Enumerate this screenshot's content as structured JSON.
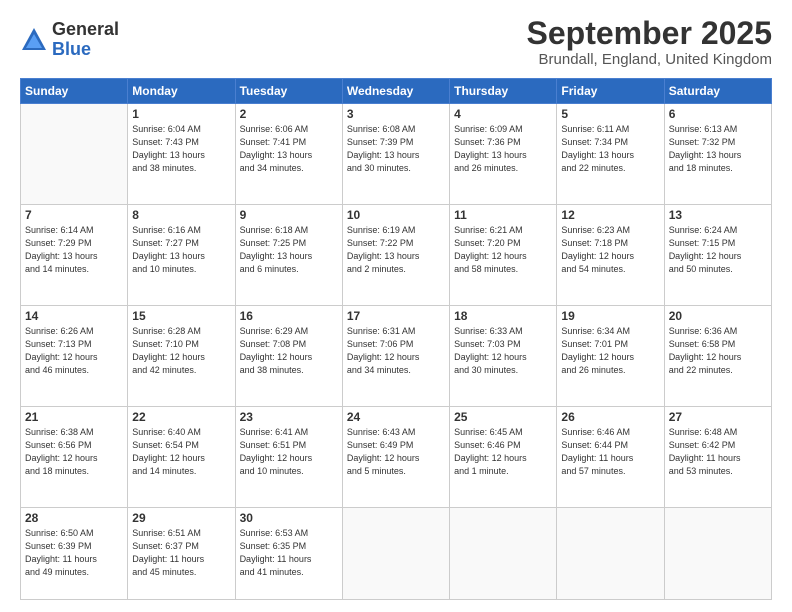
{
  "header": {
    "logo_general": "General",
    "logo_blue": "Blue",
    "month": "September 2025",
    "location": "Brundall, England, United Kingdom"
  },
  "weekdays": [
    "Sunday",
    "Monday",
    "Tuesday",
    "Wednesday",
    "Thursday",
    "Friday",
    "Saturday"
  ],
  "weeks": [
    [
      {
        "day": "",
        "info": ""
      },
      {
        "day": "1",
        "info": "Sunrise: 6:04 AM\nSunset: 7:43 PM\nDaylight: 13 hours\nand 38 minutes."
      },
      {
        "day": "2",
        "info": "Sunrise: 6:06 AM\nSunset: 7:41 PM\nDaylight: 13 hours\nand 34 minutes."
      },
      {
        "day": "3",
        "info": "Sunrise: 6:08 AM\nSunset: 7:39 PM\nDaylight: 13 hours\nand 30 minutes."
      },
      {
        "day": "4",
        "info": "Sunrise: 6:09 AM\nSunset: 7:36 PM\nDaylight: 13 hours\nand 26 minutes."
      },
      {
        "day": "5",
        "info": "Sunrise: 6:11 AM\nSunset: 7:34 PM\nDaylight: 13 hours\nand 22 minutes."
      },
      {
        "day": "6",
        "info": "Sunrise: 6:13 AM\nSunset: 7:32 PM\nDaylight: 13 hours\nand 18 minutes."
      }
    ],
    [
      {
        "day": "7",
        "info": "Sunrise: 6:14 AM\nSunset: 7:29 PM\nDaylight: 13 hours\nand 14 minutes."
      },
      {
        "day": "8",
        "info": "Sunrise: 6:16 AM\nSunset: 7:27 PM\nDaylight: 13 hours\nand 10 minutes."
      },
      {
        "day": "9",
        "info": "Sunrise: 6:18 AM\nSunset: 7:25 PM\nDaylight: 13 hours\nand 6 minutes."
      },
      {
        "day": "10",
        "info": "Sunrise: 6:19 AM\nSunset: 7:22 PM\nDaylight: 13 hours\nand 2 minutes."
      },
      {
        "day": "11",
        "info": "Sunrise: 6:21 AM\nSunset: 7:20 PM\nDaylight: 12 hours\nand 58 minutes."
      },
      {
        "day": "12",
        "info": "Sunrise: 6:23 AM\nSunset: 7:18 PM\nDaylight: 12 hours\nand 54 minutes."
      },
      {
        "day": "13",
        "info": "Sunrise: 6:24 AM\nSunset: 7:15 PM\nDaylight: 12 hours\nand 50 minutes."
      }
    ],
    [
      {
        "day": "14",
        "info": "Sunrise: 6:26 AM\nSunset: 7:13 PM\nDaylight: 12 hours\nand 46 minutes."
      },
      {
        "day": "15",
        "info": "Sunrise: 6:28 AM\nSunset: 7:10 PM\nDaylight: 12 hours\nand 42 minutes."
      },
      {
        "day": "16",
        "info": "Sunrise: 6:29 AM\nSunset: 7:08 PM\nDaylight: 12 hours\nand 38 minutes."
      },
      {
        "day": "17",
        "info": "Sunrise: 6:31 AM\nSunset: 7:06 PM\nDaylight: 12 hours\nand 34 minutes."
      },
      {
        "day": "18",
        "info": "Sunrise: 6:33 AM\nSunset: 7:03 PM\nDaylight: 12 hours\nand 30 minutes."
      },
      {
        "day": "19",
        "info": "Sunrise: 6:34 AM\nSunset: 7:01 PM\nDaylight: 12 hours\nand 26 minutes."
      },
      {
        "day": "20",
        "info": "Sunrise: 6:36 AM\nSunset: 6:58 PM\nDaylight: 12 hours\nand 22 minutes."
      }
    ],
    [
      {
        "day": "21",
        "info": "Sunrise: 6:38 AM\nSunset: 6:56 PM\nDaylight: 12 hours\nand 18 minutes."
      },
      {
        "day": "22",
        "info": "Sunrise: 6:40 AM\nSunset: 6:54 PM\nDaylight: 12 hours\nand 14 minutes."
      },
      {
        "day": "23",
        "info": "Sunrise: 6:41 AM\nSunset: 6:51 PM\nDaylight: 12 hours\nand 10 minutes."
      },
      {
        "day": "24",
        "info": "Sunrise: 6:43 AM\nSunset: 6:49 PM\nDaylight: 12 hours\nand 5 minutes."
      },
      {
        "day": "25",
        "info": "Sunrise: 6:45 AM\nSunset: 6:46 PM\nDaylight: 12 hours\nand 1 minute."
      },
      {
        "day": "26",
        "info": "Sunrise: 6:46 AM\nSunset: 6:44 PM\nDaylight: 11 hours\nand 57 minutes."
      },
      {
        "day": "27",
        "info": "Sunrise: 6:48 AM\nSunset: 6:42 PM\nDaylight: 11 hours\nand 53 minutes."
      }
    ],
    [
      {
        "day": "28",
        "info": "Sunrise: 6:50 AM\nSunset: 6:39 PM\nDaylight: 11 hours\nand 49 minutes."
      },
      {
        "day": "29",
        "info": "Sunrise: 6:51 AM\nSunset: 6:37 PM\nDaylight: 11 hours\nand 45 minutes."
      },
      {
        "day": "30",
        "info": "Sunrise: 6:53 AM\nSunset: 6:35 PM\nDaylight: 11 hours\nand 41 minutes."
      },
      {
        "day": "",
        "info": ""
      },
      {
        "day": "",
        "info": ""
      },
      {
        "day": "",
        "info": ""
      },
      {
        "day": "",
        "info": ""
      }
    ]
  ]
}
